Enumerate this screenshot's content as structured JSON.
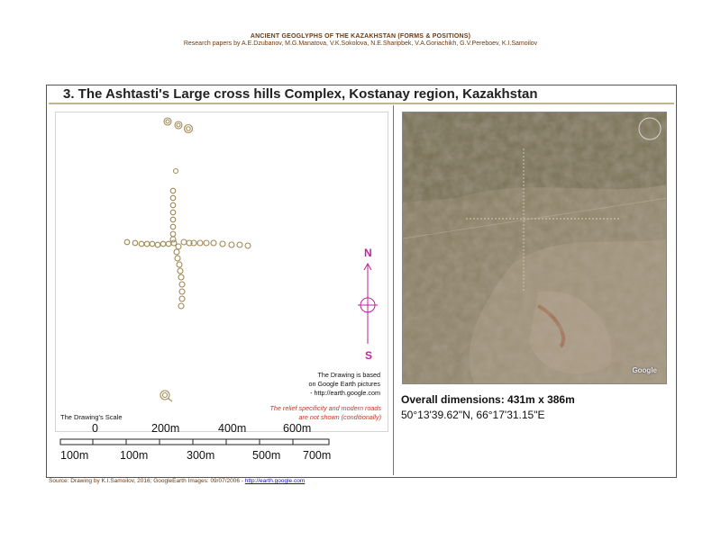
{
  "header": {
    "title": "ANCIENT GEOGLYPHS OF THE KAZAKHSTAN (FORMS & POSITIONS)",
    "authors": "Research papers by A.E.Dzubanov, M.G.Manatova, V.K.Sokolova, N.E.Sharipbek, V.A.Goriachikh, G.V.Pereboev, K.I.Samoilov"
  },
  "section": {
    "title": "3. The Ashtasti's Large cross hills Complex, Kostanay region, Kazakhstan"
  },
  "drawing": {
    "compass": {
      "north": "N",
      "south": "S"
    },
    "based_note": [
      "The Drawing is based",
      "on Google Earth pictures",
      "- http://earth.google.com"
    ],
    "relief_note": [
      "The relief specificity and modern roads",
      "are not shown (conditionally)"
    ],
    "scale": {
      "label": "The Drawing's Scale",
      "top_labels": [
        "0",
        "200m",
        "400m",
        "600m"
      ],
      "bottom_labels": [
        "100m",
        "100m",
        "300m",
        "500m",
        "700m"
      ]
    }
  },
  "photo": {
    "watermark": "Google"
  },
  "info": {
    "dimensions": "Overall dimensions: 431m x 386m",
    "coordinates": "50°13'39.62\"N, 66°17'31.15\"E"
  },
  "footer": {
    "source": "Source: Drawing by K.I.Samoilov, 2016; GoogleEarth Images: 09/07/2006 - ",
    "link": "http://earth.google.com"
  },
  "colors": {
    "hill_stroke": "#a08a55",
    "compass": "#c0219a",
    "header_text": "#6b3a14",
    "relief_note": "#c0392b"
  }
}
